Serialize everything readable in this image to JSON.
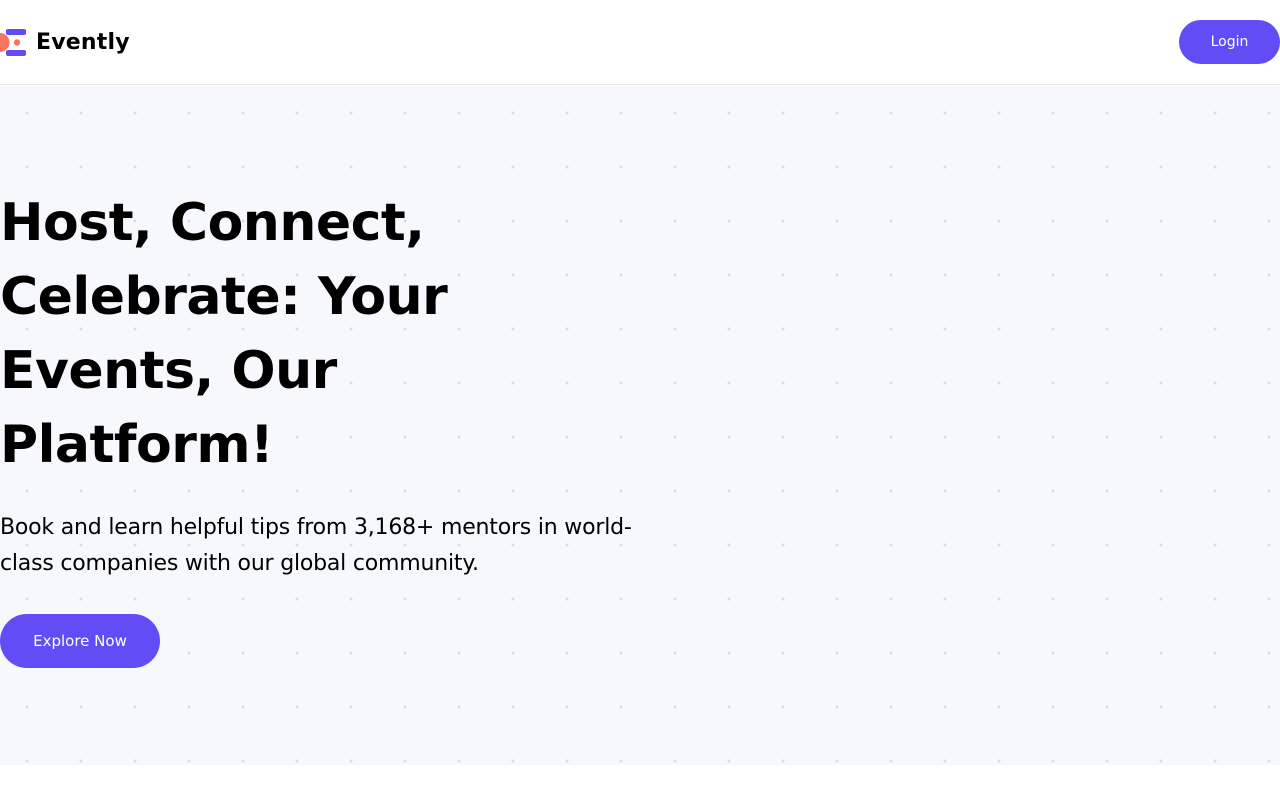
{
  "header": {
    "brand_name": "Evently",
    "logo_icon": "evently-logo-icon",
    "login_label": "Login"
  },
  "hero": {
    "title": "Host, Connect, Celebrate: Your Events, Our Platform!",
    "subtitle": "Book and learn helpful tips from 3,168+ mentors in world-class companies with our global community.",
    "cta_label": "Explore Now"
  },
  "colors": {
    "accent": "#624cf5",
    "hero_background": "#f6f8fd",
    "logo_coral": "#f97360",
    "text": "#000000"
  }
}
